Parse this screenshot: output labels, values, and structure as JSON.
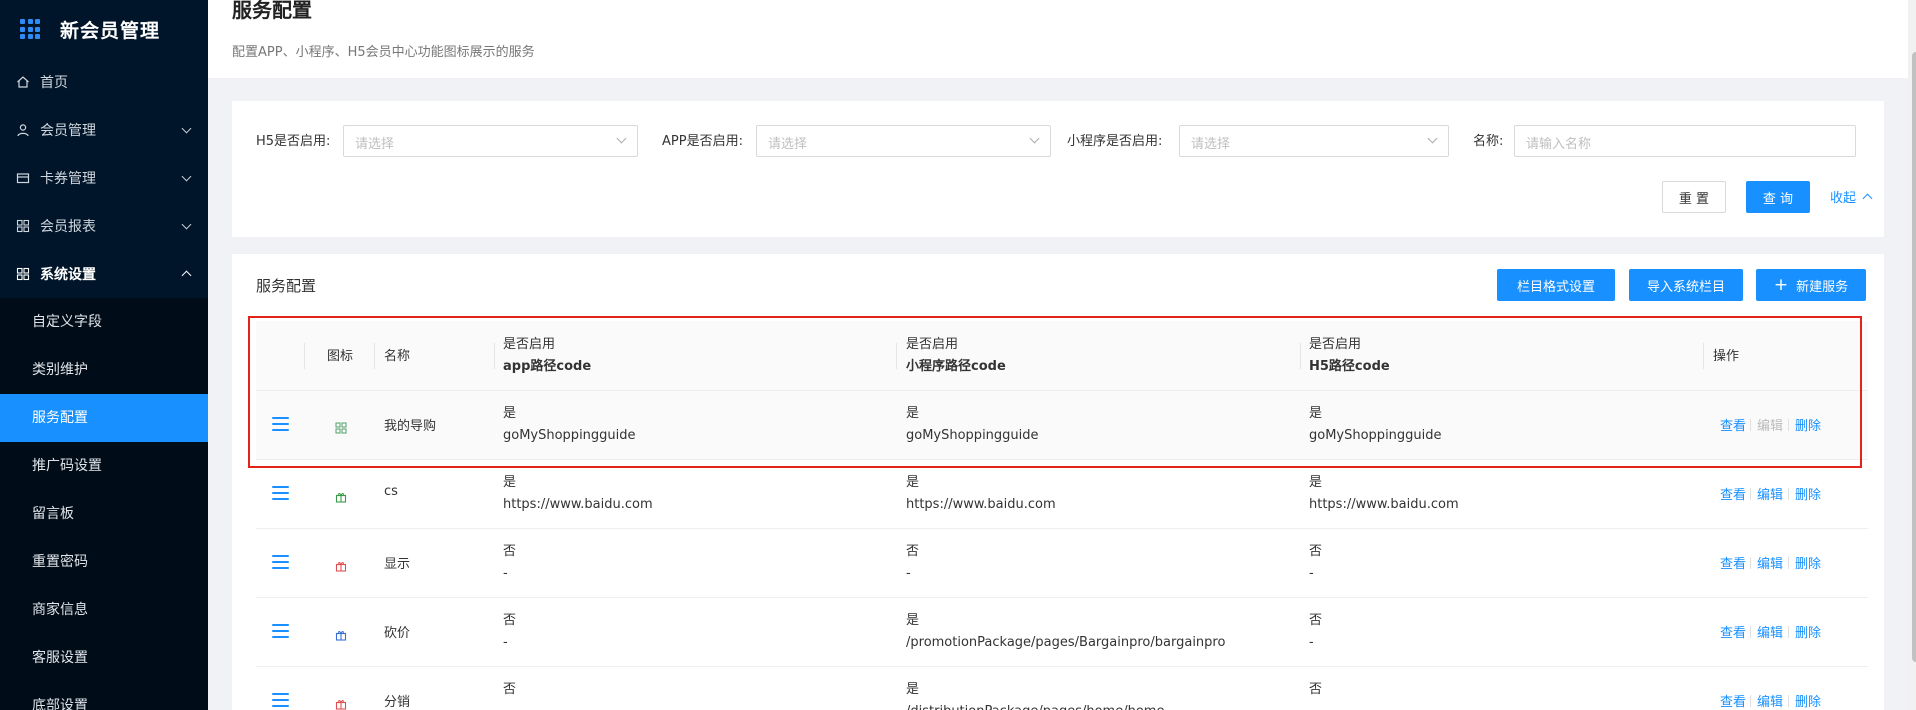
{
  "app": {
    "title": "新会员管理"
  },
  "menu": [
    {
      "label": "首页",
      "icon": "home-icon"
    },
    {
      "label": "会员管理",
      "icon": "user-icon"
    },
    {
      "label": "卡券管理",
      "icon": "wallet-icon"
    },
    {
      "label": "会员报表",
      "icon": "grid-icon"
    },
    {
      "label": "系统设置",
      "icon": "settings-grid-icon"
    }
  ],
  "submenu": [
    "自定义字段",
    "类别维护",
    "服务配置",
    "推广码设置",
    "留言板",
    "重置密码",
    "商家信息",
    "客服设置",
    "底部设置"
  ],
  "page": {
    "title": "服务配置",
    "description": "配置APP、小程序、H5会员中心功能图标展示的服务"
  },
  "filters": {
    "h5_label": "H5是否启用:",
    "app_label": "APP是否启用:",
    "mini_label": "小程序是否启用:",
    "name_label": "名称:",
    "select_placeholder": "请选择",
    "name_placeholder": "请输入名称",
    "reset": "重 置",
    "query": "查 询",
    "collapse": "收起"
  },
  "table_card": {
    "title": "服务配置",
    "btn_format": "栏目格式设置",
    "btn_import": "导入系统栏目",
    "btn_new": "新建服务",
    "plus": "+"
  },
  "columns": {
    "icon": "图标",
    "name": "名称",
    "app_top": "是否启用",
    "app_bottom": "app路径code",
    "mini_top": "是否启用",
    "mini_bottom": "小程序路径code",
    "h5_top": "是否启用",
    "h5_bottom": "H5路径code",
    "actions": "操作"
  },
  "actions": {
    "view": "查看",
    "edit": "编辑",
    "delete": "删除"
  },
  "rows": [
    {
      "name": "我的导购",
      "icon": "grid-icon",
      "icon_color": "#52a06a",
      "app_enabled": "是",
      "app_code": "goMyShoppingguide",
      "mini_enabled": "是",
      "mini_code": "goMyShoppingguide",
      "h5_enabled": "是",
      "h5_code": "goMyShoppingguide"
    },
    {
      "name": "cs",
      "icon": "gift-icon",
      "icon_color": "#3a9a4a",
      "app_enabled": "是",
      "app_code": "https://www.baidu.com",
      "mini_enabled": "是",
      "mini_code": "https://www.baidu.com",
      "h5_enabled": "是",
      "h5_code": "https://www.baidu.com"
    },
    {
      "name": "显示",
      "icon": "gift-icon",
      "icon_color": "#e05050",
      "app_enabled": "否",
      "app_code": "-",
      "mini_enabled": "否",
      "mini_code": "-",
      "h5_enabled": "否",
      "h5_code": "-"
    },
    {
      "name": "砍价",
      "icon": "gift-icon",
      "icon_color": "#3a6fd8",
      "app_enabled": "否",
      "app_code": "-",
      "mini_enabled": "是",
      "mini_code": "/promotionPackage/pages/Bargainpro/bargainpro",
      "h5_enabled": "否",
      "h5_code": "-"
    },
    {
      "name": "分销",
      "icon": "gift-icon",
      "icon_color": "#e05050",
      "app_enabled": "否",
      "app_code": "-",
      "mini_enabled": "是",
      "mini_code": "/distributionPackage/pages/home/home",
      "h5_enabled": "否",
      "h5_code": "-"
    }
  ],
  "colors": {
    "sidebar": "#001529",
    "accent": "#1890ff",
    "highlight_border": "#e2231a"
  }
}
